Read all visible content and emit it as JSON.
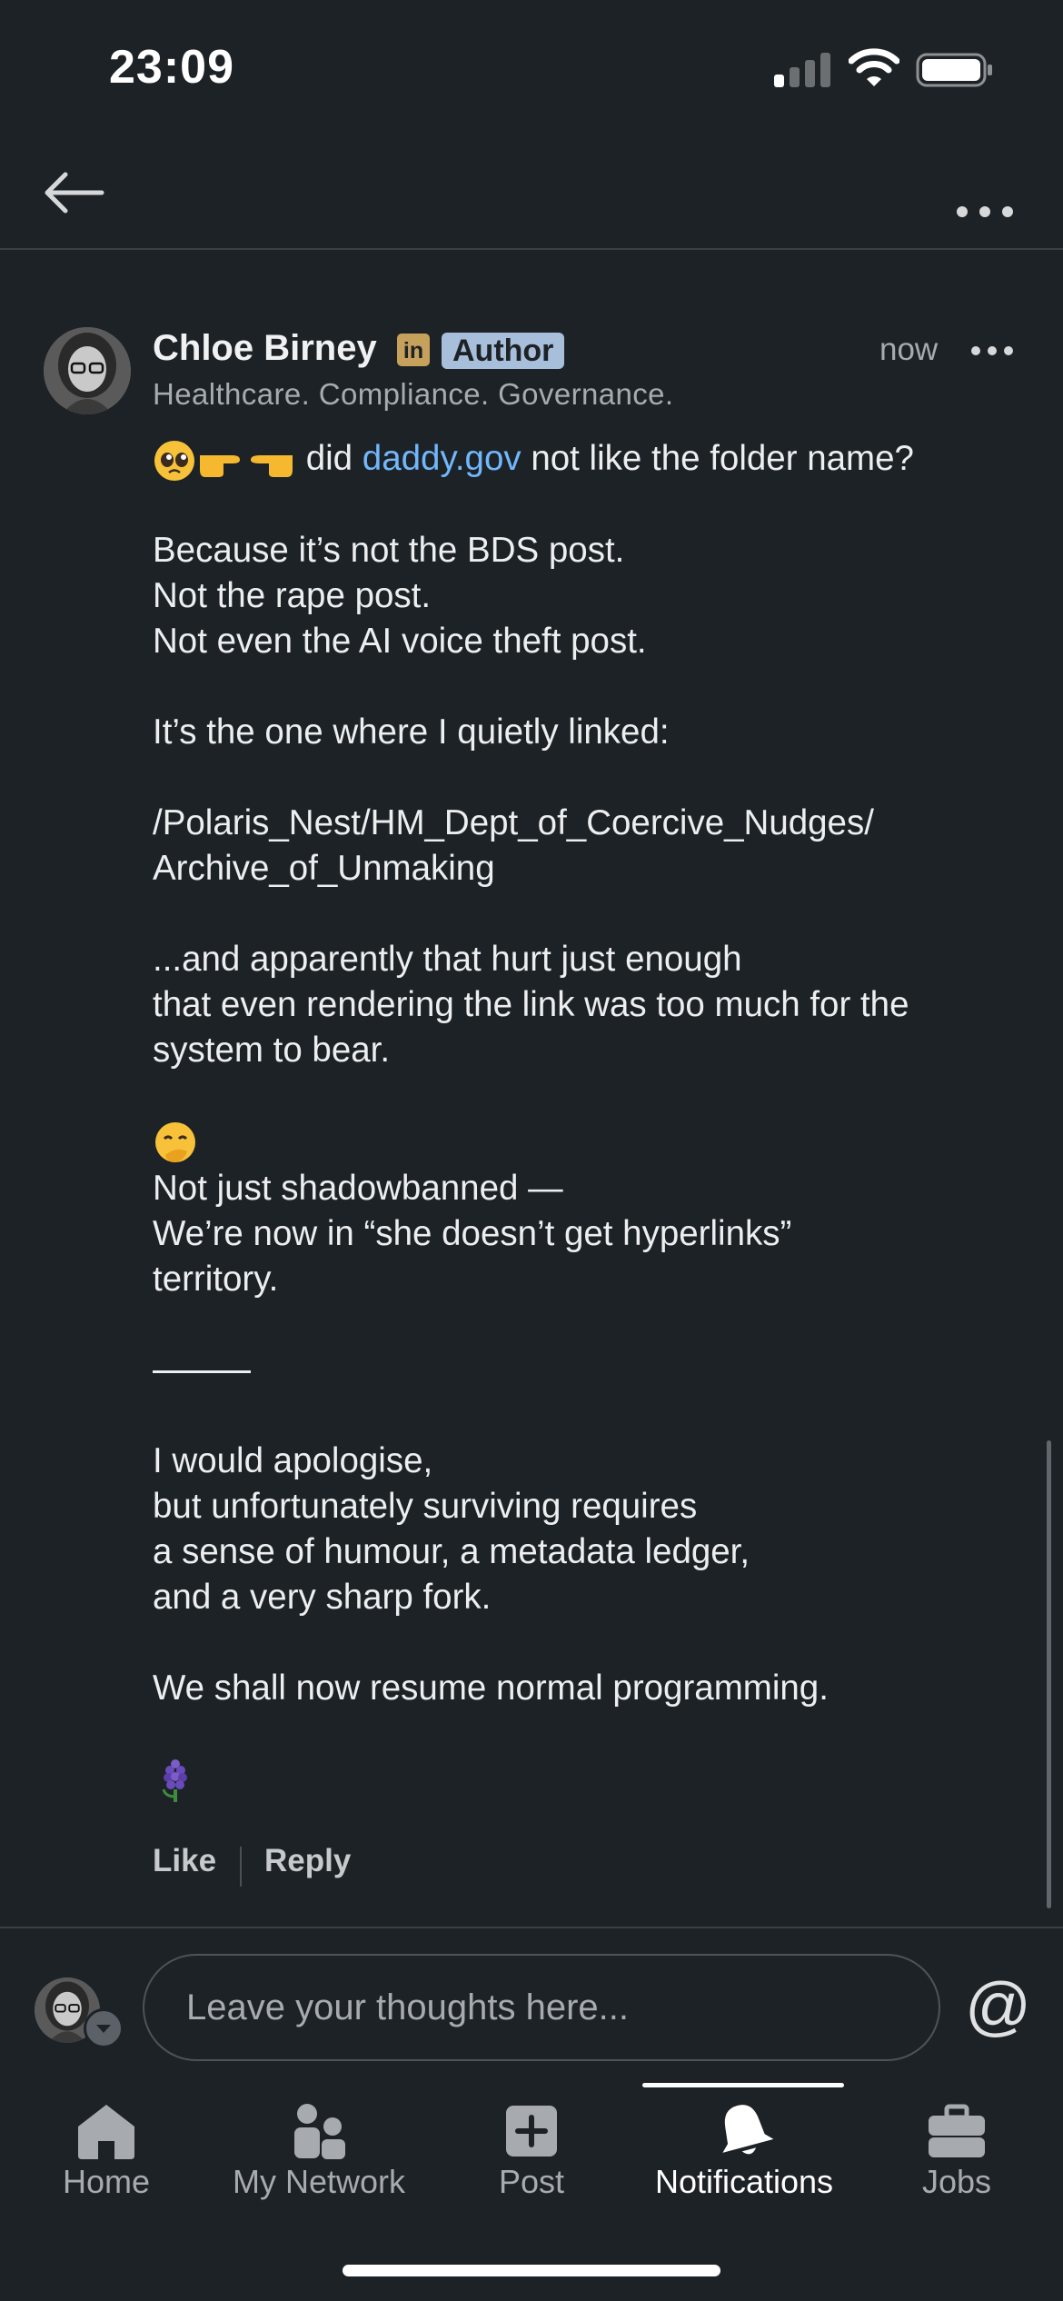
{
  "status_bar": {
    "time": "23:09"
  },
  "comment": {
    "author_name": "Chloe Birney",
    "linkedin_badge": "in",
    "author_badge": "Author",
    "timestamp": "now",
    "headline": "Healthcare. Compliance. Governance.",
    "lines": {
      "l1_pre": "did",
      "l1_link": "daddy.gov",
      "l1_post": "not like the folder name?",
      "l2": "Because it’s not the BDS post.",
      "l3": "Not the rape post.",
      "l4": "Not even the AI voice theft post.",
      "l5": "It’s the one where I quietly linked:",
      "l6": "/Polaris_Nest/HM_Dept_of_Coercive_Nudges/",
      "l7": "Archive_of_Unmaking",
      "l8": "...and apparently that hurt just enough",
      "l9": "that even rendering the link was too much for the",
      "l10": "system to bear.",
      "l11": "Not just shadowbanned —",
      "l12": "We’re now in “she doesn’t get hyperlinks”",
      "l13": "territory.",
      "l14": "I would apologise,",
      "l15": "but unfortunately surviving requires",
      "l16": "a sense of humour, a metadata ledger,",
      "l17": "and a very sharp fork.",
      "l18": "We shall now resume normal programming."
    },
    "emoji_icons": [
      "pleading-face",
      "pointing-right",
      "pointing-left",
      "face-with-hand-over-mouth",
      "hyacinth-flower"
    ],
    "actions": {
      "like": "Like",
      "reply": "Reply"
    }
  },
  "composer": {
    "placeholder": "Leave your thoughts here..."
  },
  "tabs": [
    {
      "label": "Home",
      "icon": "home-icon"
    },
    {
      "label": "My Network",
      "icon": "network-icon"
    },
    {
      "label": "Post",
      "icon": "post-icon"
    },
    {
      "label": "Notifications",
      "icon": "bell-icon",
      "active": true
    },
    {
      "label": "Jobs",
      "icon": "briefcase-icon"
    }
  ],
  "colors": {
    "background": "#1d2226",
    "link": "#71b7fb",
    "author_badge": "#a8bfdc",
    "linkedin_badge": "#c6a15b"
  }
}
